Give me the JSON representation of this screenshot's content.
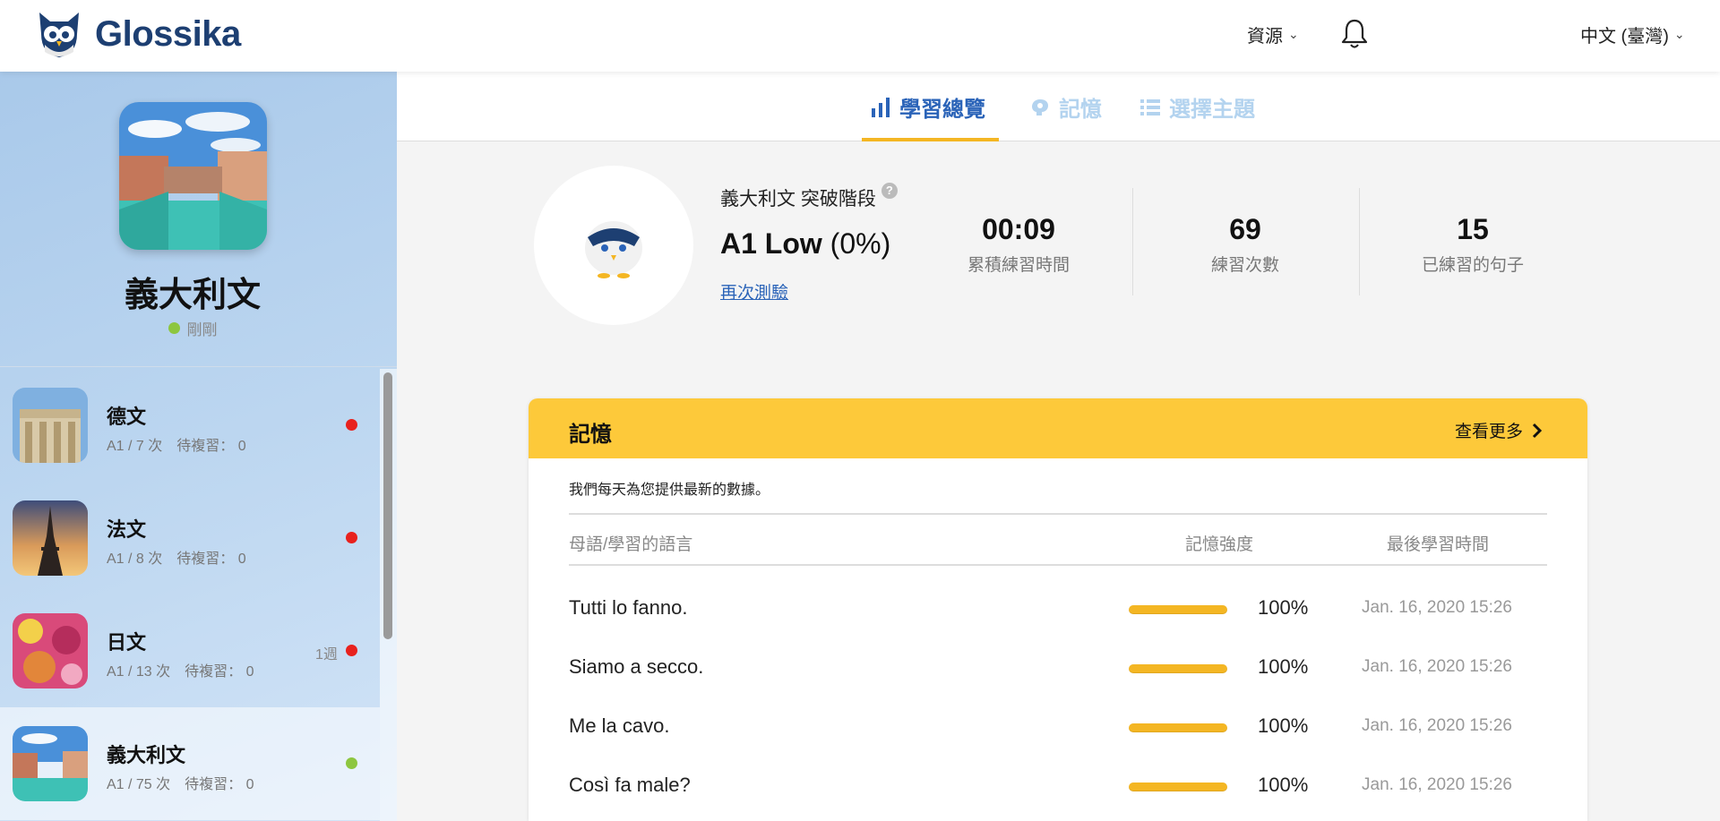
{
  "header": {
    "brand": "Glossika",
    "resources_label": "資源",
    "language_label": "中文 (臺灣)"
  },
  "sidebar": {
    "profile": {
      "name": "義大利文",
      "status": "剛剛"
    },
    "languages": [
      {
        "name": "德文",
        "meta": "A1 / 7 次　待複習： 0",
        "status": "red",
        "week": ""
      },
      {
        "name": "法文",
        "meta": "A1 / 8 次　待複習： 0",
        "status": "red",
        "week": ""
      },
      {
        "name": "日文",
        "meta": "A1 / 13 次　待複習： 0",
        "status": "red",
        "week": "1週"
      },
      {
        "name": "義大利文",
        "meta": "A1 / 75 次　待複習： 0",
        "status": "green",
        "week": ""
      }
    ]
  },
  "tabs": [
    {
      "label": "學習總覽",
      "icon": "bar-chart-icon",
      "active": true
    },
    {
      "label": "記憶",
      "icon": "brain-icon",
      "active": false
    },
    {
      "label": "選擇主題",
      "icon": "list-icon",
      "active": false
    }
  ],
  "overview": {
    "level_label": "義大利文 突破階段",
    "level_name": "A1 Low",
    "level_pct": "(0%)",
    "retest_label": "再次測驗",
    "stats": [
      {
        "value": "00:09",
        "label": "累積練習時間"
      },
      {
        "value": "69",
        "label": "練習次數"
      },
      {
        "value": "15",
        "label": "已練習的句子"
      }
    ]
  },
  "memory": {
    "title": "記憶",
    "more_label": "查看更多",
    "note": "我們每天為您提供最新的數據。",
    "columns": {
      "sentence": "母語/學習的語言",
      "strength": "記憶強度",
      "last": "最後學習時間"
    },
    "rows": [
      {
        "text": "Tutti lo fanno.",
        "strength": 1.0,
        "pct": "100%",
        "date": "Jan. 16, 2020 15:26"
      },
      {
        "text": "Siamo a secco.",
        "strength": 1.0,
        "pct": "100%",
        "date": "Jan. 16, 2020 15:26"
      },
      {
        "text": "Me la cavo.",
        "strength": 1.0,
        "pct": "100%",
        "date": "Jan. 16, 2020 15:26"
      },
      {
        "text": "Così fa male?",
        "strength": 1.0,
        "pct": "100%",
        "date": "Jan. 16, 2020 15:26"
      }
    ]
  },
  "colors": {
    "accent_blue": "#2a63b8",
    "accent_yellow": "#fdc93a",
    "bar_fill": "#f4b623",
    "status_green": "#8dc63f",
    "status_red": "#e8211d"
  }
}
